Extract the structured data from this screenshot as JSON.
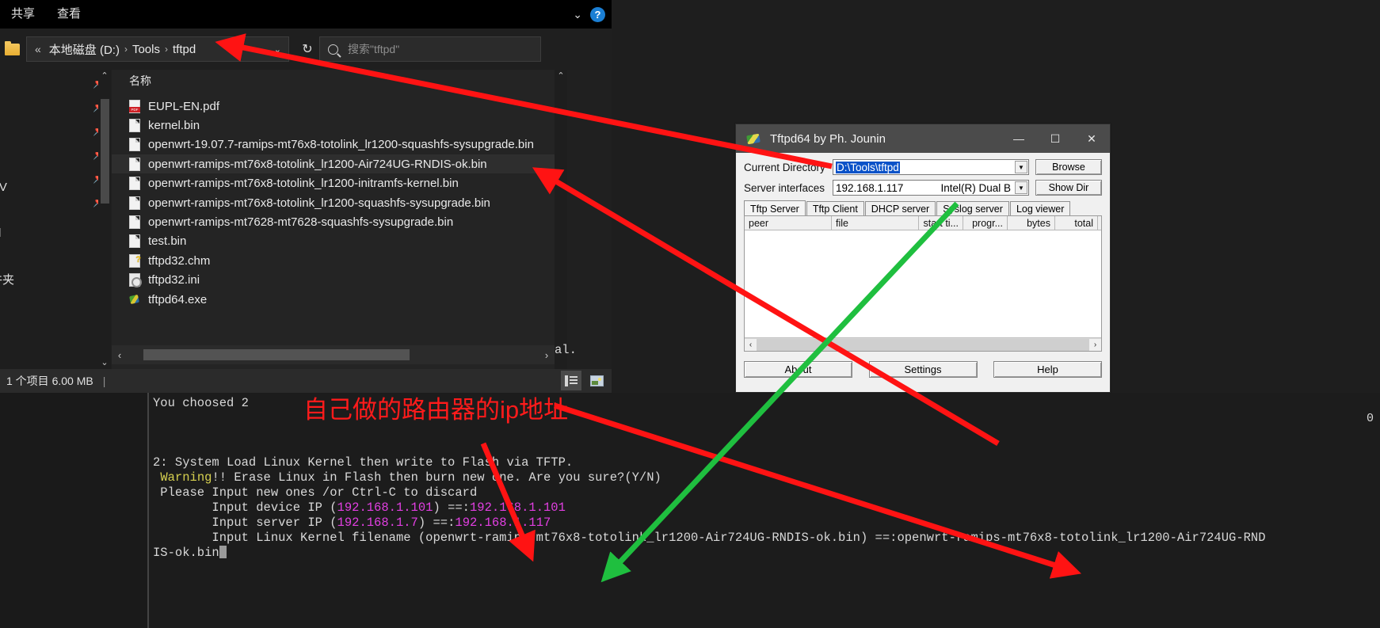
{
  "explorer": {
    "ribbon_tabs": [
      "共享",
      "查看"
    ],
    "address": {
      "chevrons": "«",
      "crumbs": [
        "本地磁盘 (D:)",
        "Tools",
        "tftpd"
      ],
      "separator": "›",
      "dropdown_caret": "⌄",
      "refresh": "↻"
    },
    "search": {
      "placeholder": "搜索\"tftpd\""
    },
    "nav_items": [
      "CV",
      "rd",
      "件夹"
    ],
    "column_header": "名称",
    "files": [
      {
        "name": "EUPL-EN.pdf",
        "icon": "pdf-file-icon",
        "type": "pdf",
        "selected": false
      },
      {
        "name": "kernel.bin",
        "icon": "generic-file-icon",
        "type": "generic",
        "selected": false
      },
      {
        "name": "openwrt-19.07.7-ramips-mt76x8-totolink_lr1200-squashfs-sysupgrade.bin",
        "icon": "generic-file-icon",
        "type": "generic",
        "selected": false
      },
      {
        "name": "openwrt-ramips-mt76x8-totolink_lr1200-Air724UG-RNDIS-ok.bin",
        "icon": "generic-file-icon",
        "type": "generic",
        "selected": true
      },
      {
        "name": "openwrt-ramips-mt76x8-totolink_lr1200-initramfs-kernel.bin",
        "icon": "generic-file-icon",
        "type": "generic",
        "selected": false
      },
      {
        "name": "openwrt-ramips-mt76x8-totolink_lr1200-squashfs-sysupgrade.bin",
        "icon": "generic-file-icon",
        "type": "generic",
        "selected": false
      },
      {
        "name": "openwrt-ramips-mt7628-mt7628-squashfs-sysupgrade.bin",
        "icon": "generic-file-icon",
        "type": "generic",
        "selected": false
      },
      {
        "name": "test.bin",
        "icon": "generic-file-icon",
        "type": "generic",
        "selected": false
      },
      {
        "name": "tftpd32.chm",
        "icon": "help-file-icon",
        "type": "chm",
        "selected": false
      },
      {
        "name": "tftpd32.ini",
        "icon": "settings-file-icon",
        "type": "ini",
        "selected": false
      },
      {
        "name": "tftpd64.exe",
        "icon": "application-file-icon",
        "type": "exe",
        "selected": false
      }
    ],
    "status": "1 个项目  6.00 MB"
  },
  "tftpd": {
    "title": "Tftpd64 by Ph. Jounin",
    "window_buttons": {
      "minimize": "—",
      "maximize": "☐",
      "close": "✕"
    },
    "current_directory": {
      "label": "Current Directory",
      "value": "D:\\Tools\\tftpd",
      "browse": "Browse"
    },
    "server_interfaces": {
      "label": "Server interfaces",
      "value": "192.168.1.117",
      "adapter": "Intel(R) Dual B",
      "show_dir": "Show Dir"
    },
    "tabs": [
      "Tftp Server",
      "Tftp Client",
      "DHCP server",
      "Syslog server",
      "Log viewer"
    ],
    "active_tab": "Tftp Server",
    "table_columns": [
      "peer",
      "file",
      "start ti...",
      "progr...",
      "bytes",
      "total"
    ],
    "table_rows": [],
    "buttons": [
      "About",
      "Settings",
      "Help"
    ]
  },
  "terminal": {
    "choice_line": "You choosed 2",
    "partial_top": "al.",
    "right_marker": "0",
    "lines": [
      {
        "text": "2: System Load Linux Kernel then write to Flash via TFTP.",
        "parts": [
          {
            "t": "2: System Load Linux Kernel then write to Flash via TFTP.",
            "c": "plain"
          }
        ]
      },
      {
        "text": " Warning!! Erase Linux in Flash then burn new one. Are you sure?(Y/N)",
        "parts": [
          {
            "t": " ",
            "c": "plain"
          },
          {
            "t": "Warning",
            "c": "warn"
          },
          {
            "t": "!! Erase Linux in Flash then burn new one. Are you sure?(Y/N)",
            "c": "plain"
          }
        ]
      },
      {
        "text": " Please Input new ones /or Ctrl-C to discard",
        "parts": [
          {
            "t": " Please Input new ones /or Ctrl-C to discard",
            "c": "plain"
          }
        ]
      },
      {
        "text": "        Input device IP (192.168.1.101) ==:192.168.1.101",
        "parts": [
          {
            "t": "        Input device IP (",
            "c": "plain"
          },
          {
            "t": "192.168.1.101",
            "c": "mag"
          },
          {
            "t": ") ==:",
            "c": "plain"
          },
          {
            "t": "192.168.1.101",
            "c": "mag"
          }
        ]
      },
      {
        "text": "        Input server IP (192.168.1.7) ==:192.168.1.117",
        "parts": [
          {
            "t": "        Input server IP (",
            "c": "plain"
          },
          {
            "t": "192.168.1.7",
            "c": "mag"
          },
          {
            "t": ") ==:",
            "c": "plain"
          },
          {
            "t": "192.168.1.117",
            "c": "mag"
          }
        ]
      },
      {
        "text": "        Input Linux Kernel filename (openwrt-ramips-mt76x8-totolink_lr1200-Air724UG-RNDIS-ok.bin) ==:openwrt-ramips-mt76x8-totolink_lr1200-Air724UG-RND",
        "parts": [
          {
            "t": "        Input Linux Kernel filename (openwrt-ramips-mt76x8-totolink_lr1200-Air724UG-RNDIS-ok.bin) ==:openwrt-ramips-mt76x8-totolink_lr1200-Air724UG-RND",
            "c": "plain"
          }
        ]
      },
      {
        "text": "IS-ok.bin",
        "parts": [
          {
            "t": "IS-ok.bin",
            "c": "plain"
          }
        ]
      }
    ]
  },
  "annotations": {
    "chinese_note": "自己做的路由器的ip地址",
    "arrow_color_red": "#ff1313",
    "arrow_color_green": "#1fbf3f"
  }
}
